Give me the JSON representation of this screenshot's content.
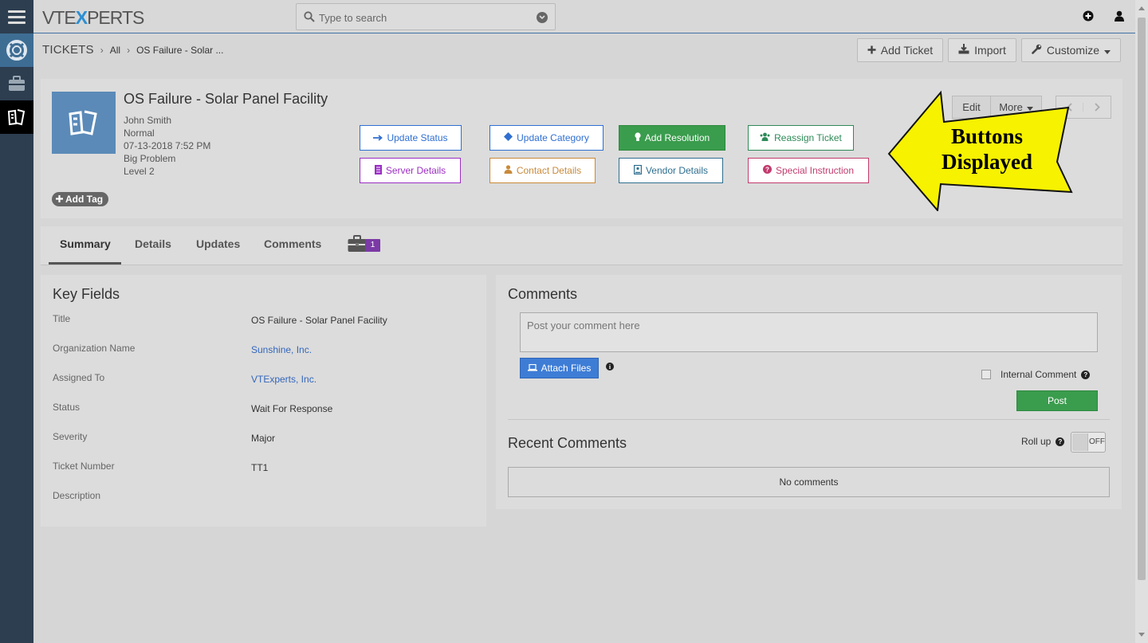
{
  "app": {
    "logo_pre": "VTE",
    "logo_x": "X",
    "logo_post": "PERTS"
  },
  "search": {
    "placeholder": "Type to search"
  },
  "breadcrumb": {
    "module": "TICKETS",
    "list": "All",
    "record": "OS Failure - Solar ..."
  },
  "header_buttons": {
    "add_ticket": "Add Ticket",
    "import": "Import",
    "customize": "Customize"
  },
  "record": {
    "title": "OS Failure - Solar Panel Facility",
    "owner": "John Smith",
    "priority": "Normal",
    "date": "07-13-2018 7:52 PM",
    "category": "Big Problem",
    "level": "Level 2",
    "add_tag": "Add Tag",
    "edit": "Edit",
    "more": "More"
  },
  "actions": {
    "update_status": "Update Status",
    "update_category": "Update Category",
    "add_resolution": "Add Resolution",
    "reassign_ticket": "Reassign Ticket",
    "server_details": "Server Details",
    "contact_details": "Contact Details",
    "vendor_details": "Vendor Details",
    "special_instruction": "Special Instruction"
  },
  "callout": {
    "line1": "Buttons",
    "line2": "Displayed"
  },
  "tabs": {
    "summary": "Summary",
    "details": "Details",
    "updates": "Updates",
    "comments": "Comments",
    "badge": "1"
  },
  "key_fields": {
    "heading": "Key Fields",
    "rows": [
      {
        "label": "Title",
        "value": "OS Failure - Solar Panel Facility"
      },
      {
        "label": "Organization Name",
        "value": "Sunshine, Inc."
      },
      {
        "label": "Assigned To",
        "value": "VTExperts, Inc."
      },
      {
        "label": "Status",
        "value": "Wait For Response"
      },
      {
        "label": "Severity",
        "value": "Major"
      },
      {
        "label": "Ticket Number",
        "value": "TT1"
      },
      {
        "label": "Description",
        "value": ""
      }
    ]
  },
  "comments": {
    "heading": "Comments",
    "placeholder": "Post your comment here",
    "attach": "Attach Files",
    "internal": "Internal Comment",
    "post": "Post",
    "recent": "Recent Comments",
    "rollup": "Roll up",
    "toggle": "OFF",
    "empty": "No comments"
  },
  "colors": {
    "update_status": "#2f6fd1",
    "update_category": "#2f6fd1",
    "add_resolution": "#3a9c4d",
    "reassign_ticket": "#2e8a57",
    "server_details": "#9b2fc4",
    "contact_details": "#c88a3a",
    "vendor_details": "#2e6f8f",
    "special_instruction": "#c23b6e"
  }
}
